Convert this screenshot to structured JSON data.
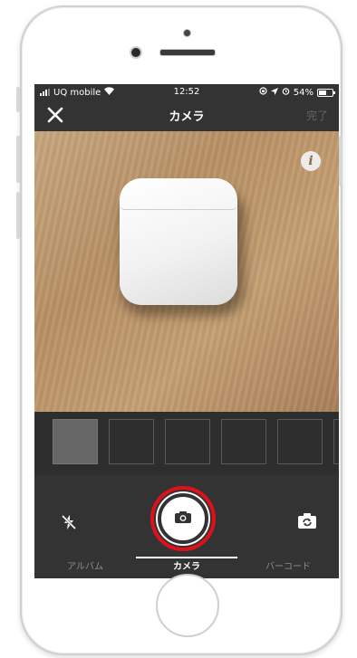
{
  "status_bar": {
    "carrier": "UQ mobile",
    "time": "12:52",
    "battery": "54%",
    "battery_level": 0.54
  },
  "nav": {
    "title": "カメラ",
    "close_icon": "close-icon",
    "done_label": "完了"
  },
  "viewfinder": {
    "info_label": "i"
  },
  "thumbnails": {
    "count": 6,
    "active_index": 0
  },
  "controls": {
    "flash_icon": "flash-off-icon",
    "shutter_icon": "camera-icon",
    "switch_icon": "switch-camera-icon"
  },
  "tabs": [
    {
      "label": "アルバム"
    },
    {
      "label": "カメラ"
    },
    {
      "label": "バーコード"
    }
  ],
  "active_tab": 1,
  "colors": {
    "shutter_ring": "#e0101a",
    "toolbar_bg": "#333333"
  }
}
